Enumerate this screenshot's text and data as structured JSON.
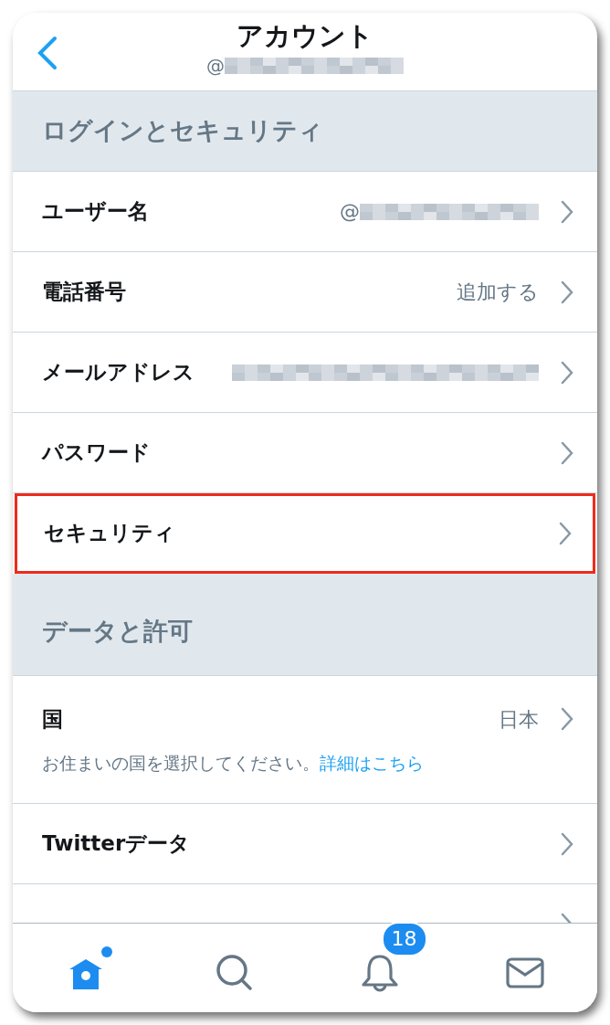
{
  "header": {
    "title": "アカウント",
    "subtitle": "@",
    "subtitle_redacted": true
  },
  "sections": [
    {
      "title": "ログインとセキュリティ",
      "items": [
        {
          "label": "ユーザー名",
          "value": "@",
          "redacted": true,
          "highlighted": false
        },
        {
          "label": "電話番号",
          "value": "追加する",
          "redacted": false,
          "highlighted": false
        },
        {
          "label": "メールアドレス",
          "redacted": true,
          "highlighted": false
        },
        {
          "label": "パスワード",
          "redacted": false,
          "highlighted": false
        },
        {
          "label": "セキュリティ",
          "redacted": false,
          "highlighted": true
        }
      ]
    },
    {
      "title": "データと許可",
      "items": [
        {
          "label": "国",
          "value": "日本",
          "note": "お住まいの国を選択してください。",
          "note_link": "詳細はこちら",
          "redacted": false,
          "highlighted": false
        },
        {
          "label": "Twitterデータ",
          "redacted": false,
          "highlighted": false
        },
        {
          "redacted": false,
          "highlighted": false
        }
      ]
    }
  ],
  "tabbar": [
    {
      "kind": "home",
      "selected": true,
      "dot": true
    },
    {
      "kind": "search",
      "selected": false
    },
    {
      "kind": "notifications",
      "selected": false,
      "badge": "18"
    },
    {
      "kind": "messages",
      "selected": false
    }
  ]
}
